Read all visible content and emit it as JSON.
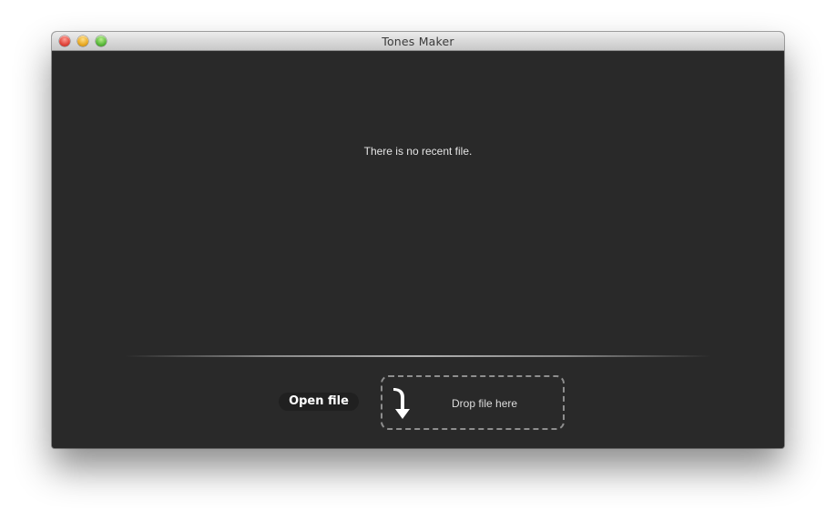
{
  "window": {
    "title": "Tones Maker"
  },
  "recent": {
    "empty_message": "There is no recent file."
  },
  "actions": {
    "open_file_label": "Open file",
    "drop_label": "Drop file here"
  },
  "icons": {
    "close": "close-icon",
    "minimize": "minimize-icon",
    "zoom": "zoom-icon",
    "drop": "curved-down-arrow-icon"
  },
  "colors": {
    "background": "#292929",
    "titlebar": "#d6d6d6",
    "text": "#e4e4e4",
    "dashed_border": "#8e8e8e"
  }
}
